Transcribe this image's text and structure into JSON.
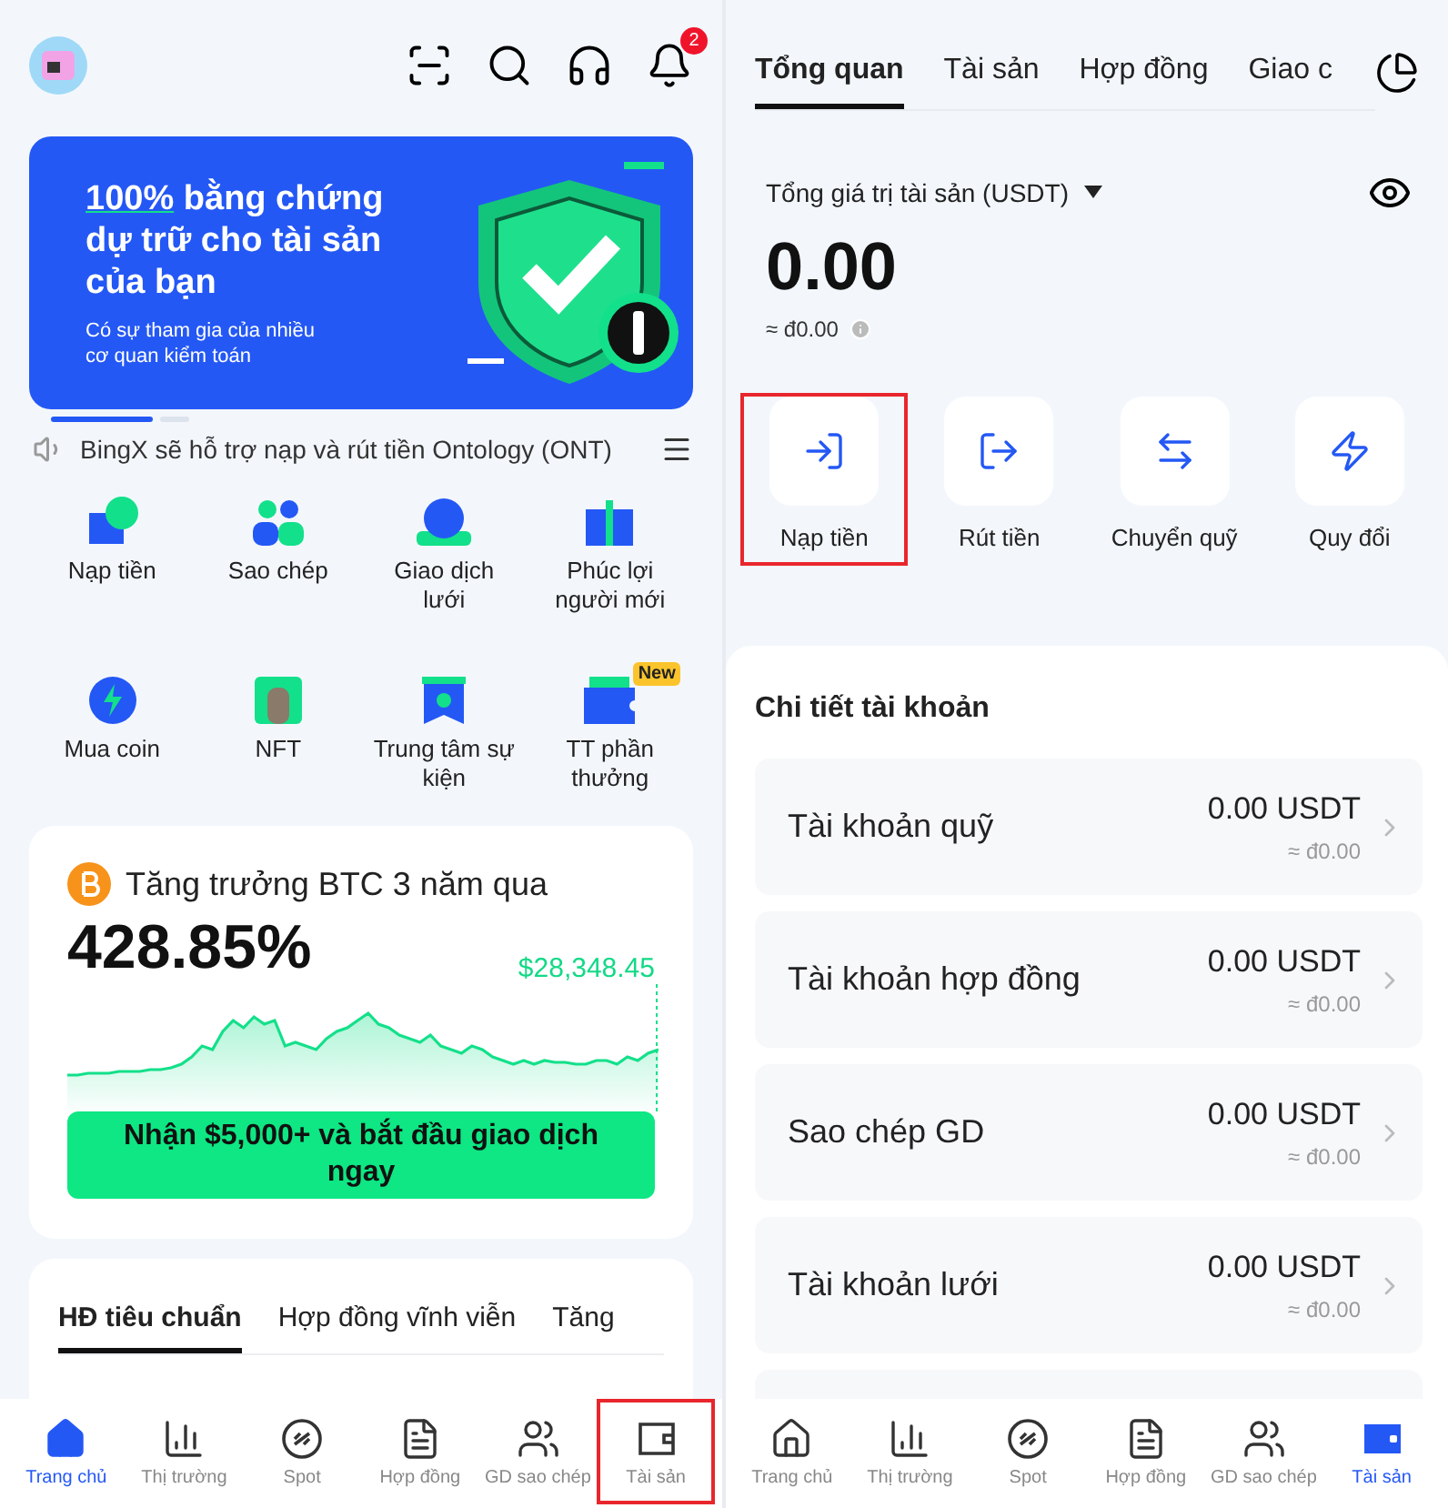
{
  "home": {
    "header": {
      "notification_count": "2"
    },
    "banner": {
      "title_lead": "100%",
      "title_rest": "bằng chứng dự trữ cho tài sản của bạn",
      "subtitle": "Có sự tham gia của nhiều cơ quan kiểm toán",
      "pages": [
        {
          "selected": true
        },
        {
          "selected": false
        }
      ]
    },
    "announcement": "BingX sẽ hỗ trợ nạp và rút tiền Ontology (ONT)",
    "shortcuts": [
      {
        "label": "Nạp tiền"
      },
      {
        "label": "Sao chép"
      },
      {
        "label": "Giao dịch lưới"
      },
      {
        "label": "Phúc lợi người mới"
      },
      {
        "label": "Mua coin"
      },
      {
        "label": "NFT"
      },
      {
        "label": "Trung tâm sự kiện"
      },
      {
        "label": "TT phần thưởng",
        "badge": "New"
      }
    ],
    "btc_card": {
      "title": "Tăng trưởng BTC 3 năm qua",
      "change": "428.85%",
      "price": "$28,348.45",
      "cta": "Nhận $5,000+ và bắt đầu giao dịch ngay"
    },
    "tabs": [
      {
        "label": "HĐ tiêu chuẩn",
        "selected": true
      },
      {
        "label": "Hợp đồng vĩnh viễn",
        "selected": false
      },
      {
        "label": "Tăng",
        "selected": false
      }
    ],
    "nav": [
      {
        "label": "Trang chủ",
        "selected": true,
        "highlighted": false
      },
      {
        "label": "Thị trường",
        "selected": false,
        "highlighted": false
      },
      {
        "label": "Spot",
        "selected": false,
        "highlighted": false
      },
      {
        "label": "Hợp đồng",
        "selected": false,
        "highlighted": false
      },
      {
        "label": "GD sao chép",
        "selected": false,
        "highlighted": false
      },
      {
        "label": "Tài sản",
        "selected": false,
        "highlighted": true
      }
    ]
  },
  "assets": {
    "tabs": [
      {
        "label": "Tổng quan",
        "selected": true
      },
      {
        "label": "Tài sản",
        "selected": false
      },
      {
        "label": "Hợp đồng",
        "selected": false
      },
      {
        "label": "Giao c",
        "selected": false
      }
    ],
    "total_label": "Tổng giá trị tài sản (USDT)",
    "total": "0.00",
    "total_fiat": "≈ đ0.00",
    "actions": [
      {
        "label": "Nạp tiền",
        "highlighted": true
      },
      {
        "label": "Rút tiền",
        "highlighted": false
      },
      {
        "label": "Chuyển quỹ",
        "highlighted": false
      },
      {
        "label": "Quy đổi",
        "highlighted": false
      }
    ],
    "section_title": "Chi tiết tài khoản",
    "accounts": [
      {
        "name": "Tài khoản quỹ",
        "amount": "0.00 USDT",
        "fiat": "≈ đ0.00"
      },
      {
        "name": "Tài khoản hợp đồng",
        "amount": "0.00 USDT",
        "fiat": "≈ đ0.00"
      },
      {
        "name": "Sao chép GD",
        "amount": "0.00 USDT",
        "fiat": "≈ đ0.00"
      },
      {
        "name": "Tài khoản lưới",
        "amount": "0.00 USDT",
        "fiat": "≈ đ0.00"
      }
    ],
    "nav": [
      {
        "label": "Trang chủ",
        "selected": false,
        "highlighted": false
      },
      {
        "label": "Thị trường",
        "selected": false,
        "highlighted": false
      },
      {
        "label": "Spot",
        "selected": false,
        "highlighted": false
      },
      {
        "label": "Hợp đồng",
        "selected": false,
        "highlighted": false
      },
      {
        "label": "GD sao chép",
        "selected": false,
        "highlighted": false
      },
      {
        "label": "Tài sản",
        "selected": true,
        "highlighted": false
      }
    ]
  }
}
